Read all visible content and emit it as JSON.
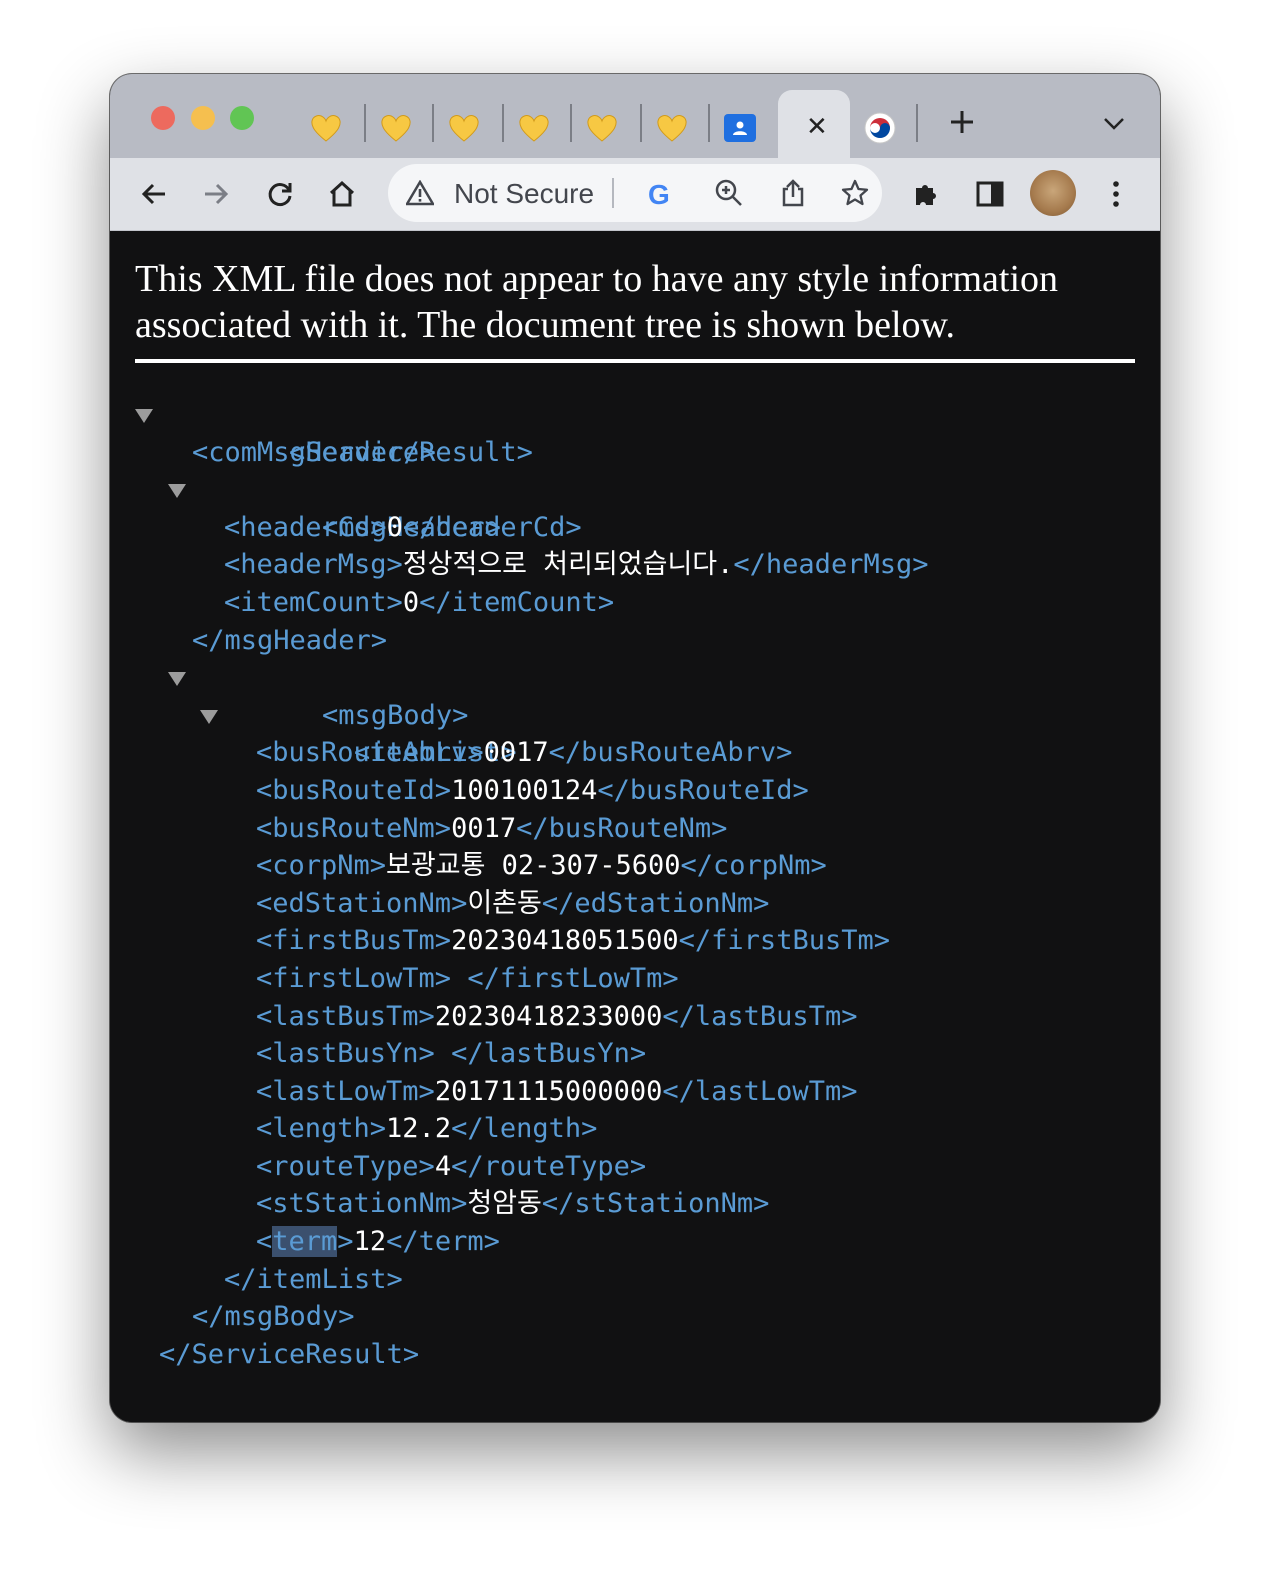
{
  "browser": {
    "tabs": [
      {
        "icon": "yellow-heart-icon"
      },
      {
        "icon": "yellow-heart-icon"
      },
      {
        "icon": "yellow-heart-icon"
      },
      {
        "icon": "yellow-heart-icon"
      },
      {
        "icon": "yellow-heart-icon"
      },
      {
        "icon": "yellow-heart-icon"
      },
      {
        "icon": "contacts-icon"
      },
      {
        "icon": "close-icon",
        "active": true
      },
      {
        "icon": "korea-flag-icon"
      }
    ],
    "close_glyph": "✕",
    "new_tab_glyph": "+",
    "address_bar": {
      "security_label": "Not Secure"
    }
  },
  "notice": {
    "text": "This XML file does not appear to have any style information associated with it. The document tree is shown below."
  },
  "xml": {
    "root_open": "<ServiceResult>",
    "comMsgHeader": "<comMsgHeader/>",
    "msgHeader_open": "<msgHeader>",
    "headerCd": {
      "open": "<headerCd>",
      "value": "0",
      "close": "</headerCd>"
    },
    "headerMsg": {
      "open": "<headerMsg>",
      "value": "정상적으로 처리되었습니다.",
      "close": "</headerMsg>"
    },
    "itemCount": {
      "open": "<itemCount>",
      "value": "0",
      "close": "</itemCount>"
    },
    "msgHeader_close": "</msgHeader>",
    "msgBody_open": "<msgBody>",
    "itemList_open": "<itemList>",
    "busRouteAbrv": {
      "open": "<busRouteAbrv>",
      "value": "0017",
      "close": "</busRouteAbrv>"
    },
    "busRouteId": {
      "open": "<busRouteId>",
      "value": "100100124",
      "close": "</busRouteId>"
    },
    "busRouteNm": {
      "open": "<busRouteNm>",
      "value": "0017",
      "close": "</busRouteNm>"
    },
    "corpNm": {
      "open": "<corpNm>",
      "value": "보광교통 02-307-5600",
      "close": "</corpNm>"
    },
    "edStationNm": {
      "open": "<edStationNm>",
      "value": "이촌동",
      "close": "</edStationNm>"
    },
    "firstBusTm": {
      "open": "<firstBusTm>",
      "value": "20230418051500",
      "close": "</firstBusTm>"
    },
    "firstLowTm": {
      "open": "<firstLowTm>",
      "value": " ",
      "close": "</firstLowTm>"
    },
    "lastBusTm": {
      "open": "<lastBusTm>",
      "value": "20230418233000",
      "close": "</lastBusTm>"
    },
    "lastBusYn": {
      "open": "<lastBusYn>",
      "value": " ",
      "close": "</lastBusYn>"
    },
    "lastLowTm": {
      "open": "<lastLowTm>",
      "value": "20171115000000",
      "close": "</lastLowTm>"
    },
    "length": {
      "open": "<length>",
      "value": "12.2",
      "close": "</length>"
    },
    "routeType": {
      "open": "<routeType>",
      "value": "4",
      "close": "</routeType>"
    },
    "stStationNm": {
      "open": "<stStationNm>",
      "value": "청암동",
      "close": "</stStationNm>"
    },
    "term": {
      "lt": "<",
      "name": "term",
      "gt": ">",
      "value": "12",
      "close": "</term>"
    },
    "itemList_close": "</itemList>",
    "msgBody_close": "</msgBody>",
    "root_close": "</ServiceResult>"
  },
  "colors": {
    "tag": "#5a9bd4",
    "text": "#ffffff",
    "background": "#111112",
    "selection": "#3b506e"
  }
}
